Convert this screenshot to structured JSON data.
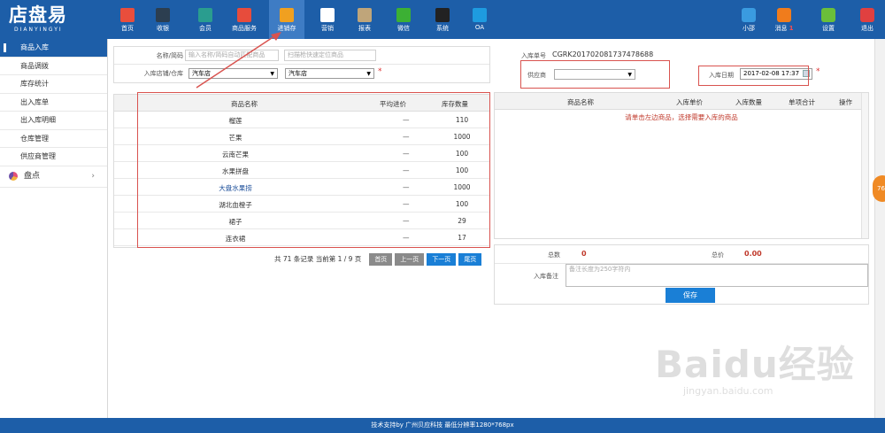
{
  "brand": {
    "name_cn": "店盘易",
    "name_en": "DIANYINGYI"
  },
  "nav": [
    {
      "label": "首页",
      "icon": "home-icon",
      "color": "#e94e3c"
    },
    {
      "label": "收银",
      "icon": "cash-register-icon",
      "color": "#2c3e50"
    },
    {
      "label": "会员",
      "icon": "member-icon",
      "color": "#2a9d8f"
    },
    {
      "label": "商品服务",
      "icon": "goods-icon",
      "color": "#e74c3c"
    },
    {
      "label": "进销存",
      "icon": "inventory-icon",
      "color": "#f0a020"
    },
    {
      "label": "营销",
      "icon": "megaphone-icon",
      "color": "#ffffff"
    },
    {
      "label": "报表",
      "icon": "report-icon",
      "color": "#bfa57a"
    },
    {
      "label": "微信",
      "icon": "wechat-icon",
      "color": "#3cb034"
    },
    {
      "label": "系统",
      "icon": "monitor-icon",
      "color": "#222222"
    },
    {
      "label": "OA",
      "icon": "oa-icon",
      "color": "#1e9be0"
    }
  ],
  "right_nav": [
    {
      "label": "小邵",
      "icon": "user-icon",
      "color": "#3a9be0"
    },
    {
      "label": "消息",
      "icon": "bell-icon",
      "color": "#f07c1c",
      "badge": "1"
    },
    {
      "label": "设置",
      "icon": "settings-icon",
      "color": "#6abf3a"
    },
    {
      "label": "退出",
      "icon": "logout-icon",
      "color": "#e04040"
    }
  ],
  "sidebar": {
    "items": [
      "商品入库",
      "商品调拨",
      "库存统计",
      "出入库单",
      "出入库明细",
      "仓库管理",
      "供应商管理"
    ],
    "group": "盘点"
  },
  "left_form": {
    "name_label": "名称/简码",
    "name_placeholder": "输入名称/简码自动匹配商品",
    "scan_placeholder": "扫描枪快速定位商品",
    "store_label": "入库店铺/仓库",
    "store_value": "汽车店",
    "warehouse_value": "汽车店",
    "required_mark": "*"
  },
  "left_table": {
    "headers": [
      "商品名称",
      "平均进价",
      "库存数量"
    ],
    "rows": [
      [
        "榴莲",
        "—",
        "110"
      ],
      [
        "芒果",
        "—",
        "1000"
      ],
      [
        "云南芒果",
        "—",
        "100"
      ],
      [
        "水果拼盘",
        "—",
        "100"
      ],
      [
        "大盘水果捞",
        "—",
        "1000"
      ],
      [
        "湖北血橙子",
        "—",
        "100"
      ],
      [
        "裙子",
        "—",
        "29"
      ],
      [
        "连衣裙",
        "—",
        "17"
      ]
    ]
  },
  "pager": {
    "info": "共 71 条记录 当前第 1 / 9 页",
    "first": "首页",
    "prev": "上一页",
    "next": "下一页",
    "last": "尾页"
  },
  "right_form": {
    "order_label": "入库单号",
    "order_no": "CGRK201702081737478688",
    "supplier_label": "供应商",
    "date_label": "入库日期",
    "date_value": "2017-02-08 17:37",
    "required_mark": "*"
  },
  "right_table": {
    "headers": [
      "商品名称",
      "入库单价",
      "入库数量",
      "单项合计",
      "操作"
    ],
    "hint": "请单击左边商品，选择需要入库的商品"
  },
  "summary": {
    "count_label": "总数",
    "count_value": "0",
    "total_label": "总价",
    "total_value": "0.00",
    "remark_label": "入库备注",
    "remark_placeholder": "备注长度为250字符内",
    "save": "保存"
  },
  "footer": "技术支持by 广州贝应科技    最低分辨率1280*768px",
  "side_bubble": "76",
  "watermark": {
    "big": "Baidu经验",
    "small": "jingyan.baidu.com"
  },
  "colors": {
    "primary": "#1d5ea8",
    "button_blue": "#1a7fd6",
    "annotation_red": "#d9534f",
    "value_red": "#c0392b"
  }
}
